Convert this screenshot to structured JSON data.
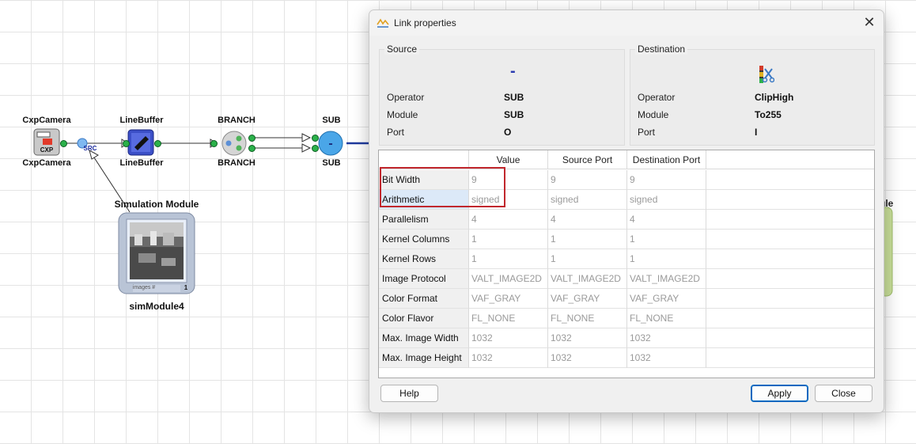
{
  "canvas": {
    "nodes": [
      {
        "top_label": "CxpCamera",
        "bottom_label": "CxpCamera",
        "icon_text": "CXP"
      },
      {
        "top_label": "LineBuffer",
        "bottom_label": "LineBuffer"
      },
      {
        "top_label": "BRANCH",
        "bottom_label": "BRANCH"
      },
      {
        "top_label": "SUB",
        "bottom_label": "SUB",
        "icon_text": "-"
      }
    ],
    "src_label": "SRC",
    "simulation": {
      "title": "Simulation Module",
      "name": "simModule4",
      "images_label": "images #",
      "images_count": "1"
    },
    "partial_right_label": "ule"
  },
  "dialog": {
    "title": "Link properties",
    "source": {
      "title": "Source",
      "icon_text": "-",
      "rows": [
        {
          "label": "Operator",
          "value": "SUB"
        },
        {
          "label": "Module",
          "value": "SUB"
        },
        {
          "label": "Port",
          "value": "O"
        }
      ]
    },
    "destination": {
      "title": "Destination",
      "icon_name": "cliphigh-icon",
      "rows": [
        {
          "label": "Operator",
          "value": "ClipHigh"
        },
        {
          "label": "Module",
          "value": "To255"
        },
        {
          "label": "Port",
          "value": "I"
        }
      ]
    },
    "table": {
      "columns": [
        "Value",
        "Source Port",
        "Destination Port"
      ],
      "rows": [
        {
          "name": "Bit Width",
          "values": [
            "9",
            "9",
            "9"
          ]
        },
        {
          "name": "Arithmetic",
          "values": [
            "signed",
            "signed",
            "signed"
          ]
        },
        {
          "name": "Parallelism",
          "values": [
            "4",
            "4",
            "4"
          ]
        },
        {
          "name": "Kernel Columns",
          "values": [
            "1",
            "1",
            "1"
          ]
        },
        {
          "name": "Kernel Rows",
          "values": [
            "1",
            "1",
            "1"
          ]
        },
        {
          "name": "Image Protocol",
          "values": [
            "VALT_IMAGE2D",
            "VALT_IMAGE2D",
            "VALT_IMAGE2D"
          ]
        },
        {
          "name": "Color Format",
          "values": [
            "VAF_GRAY",
            "VAF_GRAY",
            "VAF_GRAY"
          ]
        },
        {
          "name": "Color Flavor",
          "values": [
            "FL_NONE",
            "FL_NONE",
            "FL_NONE"
          ]
        },
        {
          "name": "Max. Image Width",
          "values": [
            "1032",
            "1032",
            "1032"
          ]
        },
        {
          "name": "Max. Image Height",
          "values": [
            "1032",
            "1032",
            "1032"
          ]
        }
      ],
      "selected_row": "Arithmetic"
    },
    "buttons": {
      "help": "Help",
      "apply": "Apply",
      "close": "Close"
    }
  },
  "colors": {
    "highlight_box": "#c1272d",
    "selected_row": "#dce9f8",
    "port_green": "#2bb14a",
    "sub_node": "#4aa6e8"
  }
}
